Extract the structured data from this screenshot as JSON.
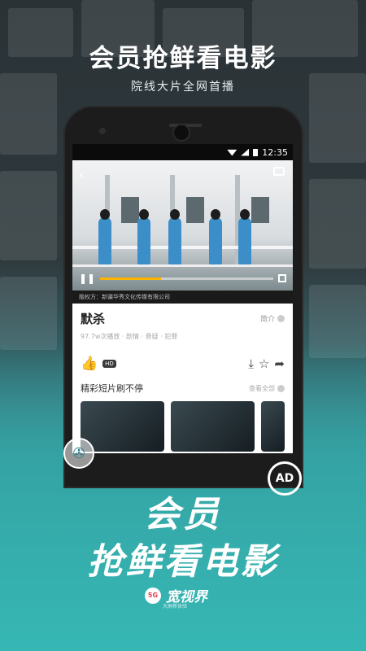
{
  "hero": {
    "title": "会员抢鲜看电影",
    "subtitle": "院线大片全网首播"
  },
  "statusbar": {
    "time": "12:35"
  },
  "player": {
    "copyright": "版权方：新疆华秀文化传媒有限公司",
    "progress": 0.35
  },
  "movie": {
    "title": "默杀",
    "intro_label": "简介",
    "meta": "97.7w次播放 · 剧情 · 悬疑 · 犯罪",
    "like_badge": "HD"
  },
  "section": {
    "title": "精彩短片刷不停",
    "more_label": "查看全部"
  },
  "banner": {
    "line1": "会员",
    "line2": "抢鲜看电影"
  },
  "badges": {
    "ad": "AD"
  },
  "brand": {
    "badge": "5G",
    "name": "宽视界",
    "slogan": "大屏新体验"
  },
  "colors": {
    "teal": "#36b7b4",
    "accent": "#ffb400",
    "like": "#2b6fd6"
  },
  "icons": {
    "back": "chevron-left-icon",
    "cast": "cast-icon",
    "pause": "pause-icon",
    "fullscreen": "fullscreen-icon",
    "like": "thumbs-up-icon",
    "download": "download-icon",
    "star": "star-icon",
    "share": "share-icon",
    "film": "film-reel-icon",
    "no-ad": "no-ad-icon"
  }
}
